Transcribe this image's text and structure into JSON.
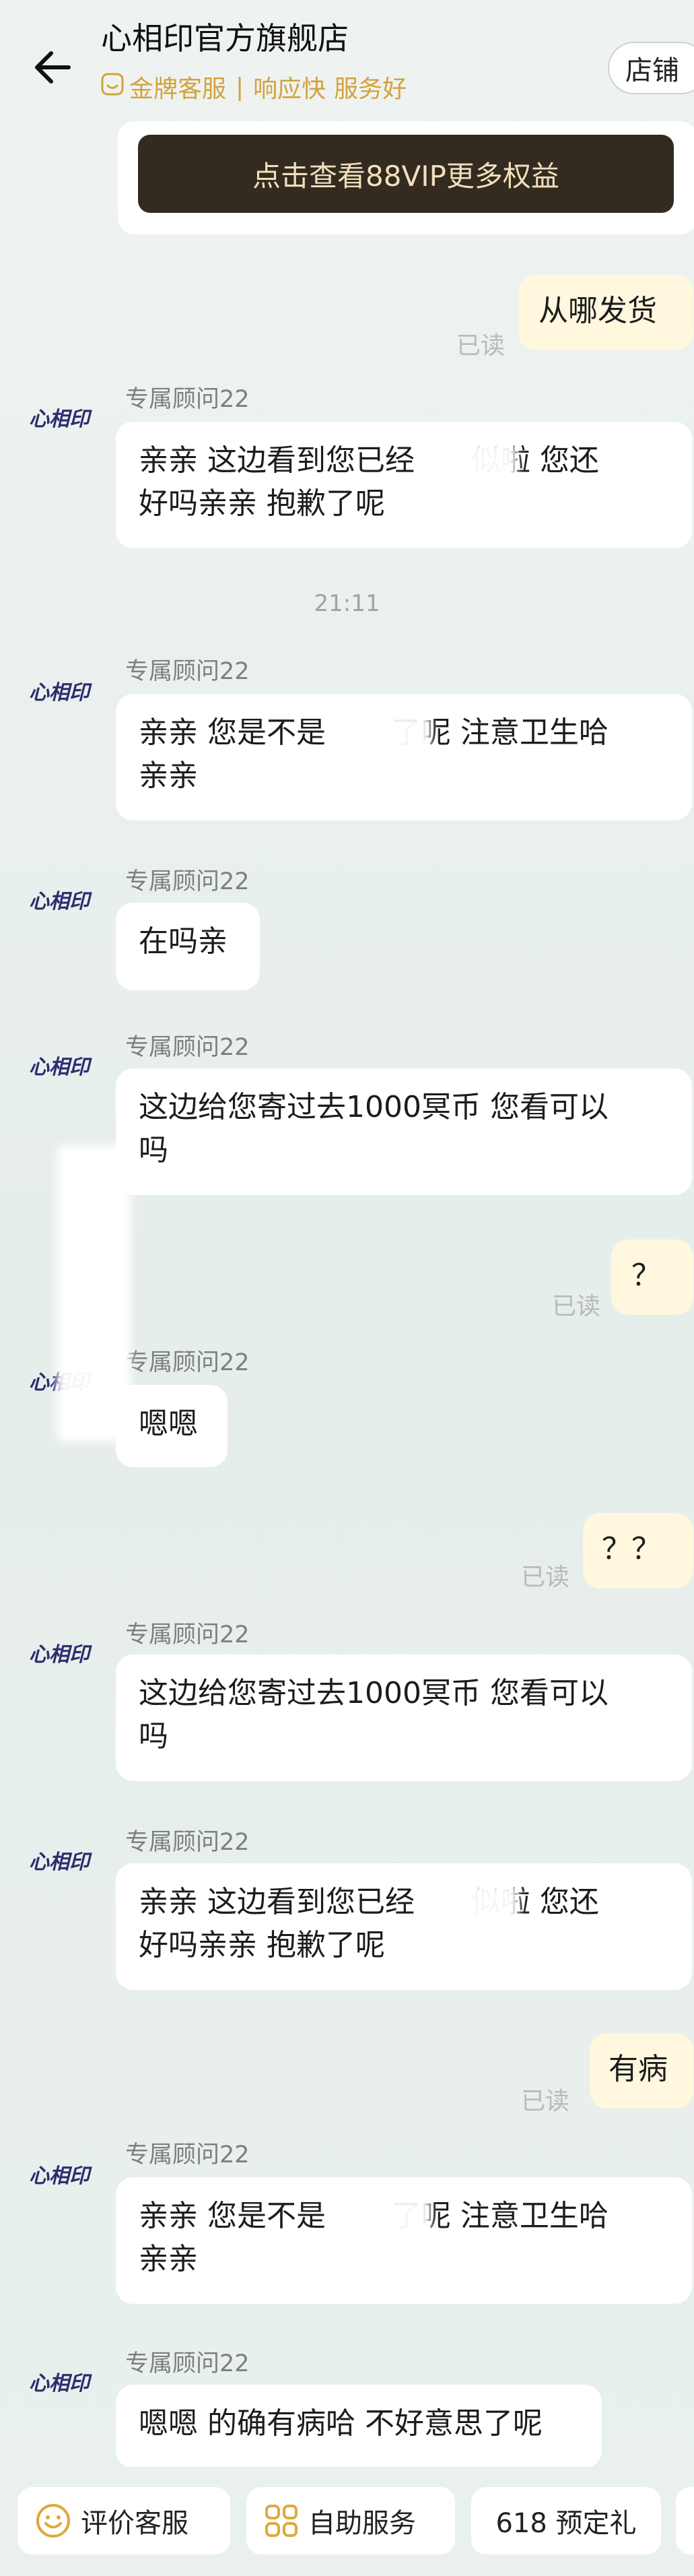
{
  "header": {
    "title": "心相印官方旗舰店",
    "badge": "金牌客服",
    "tag1": "响应快",
    "tag2": "服务好",
    "divider": "|",
    "store_button": "店铺",
    "accent_color": "#d4a23a"
  },
  "vip": {
    "label": "点击查看88VIP更多权益"
  },
  "brand": {
    "avatar_text": "心相印"
  },
  "messages": [
    {
      "from": "me",
      "text": "从哪发货",
      "status": "已读"
    },
    {
      "from": "agent",
      "sender": "专属顾问22",
      "text": "亲亲 这边看到您已经      似啦 您还\n好吗亲亲 抱歉了呢"
    },
    {
      "type": "time",
      "text": "21:11"
    },
    {
      "from": "agent",
      "sender": "专属顾问22",
      "text": "亲亲 您是不是       了呢 注意卫生哈\n亲亲"
    },
    {
      "from": "agent",
      "sender": "专属顾问22",
      "text": "在吗亲"
    },
    {
      "from": "agent",
      "sender": "专属顾问22",
      "text": "这边给您寄过去1000冥币 您看可以\n吗"
    },
    {
      "from": "me",
      "text": "？",
      "status": "已读"
    },
    {
      "from": "agent",
      "sender": "专属顾问22",
      "text": "嗯嗯"
    },
    {
      "from": "me",
      "text": "？？",
      "status": "已读"
    },
    {
      "from": "agent",
      "sender": "专属顾问22",
      "text": "这边给您寄过去1000冥币 您看可以\n吗"
    },
    {
      "from": "agent",
      "sender": "专属顾问22",
      "text": "亲亲 这边看到您已经      似啦 您还\n好吗亲亲 抱歉了呢"
    },
    {
      "from": "me",
      "text": "有病",
      "status": "已读"
    },
    {
      "from": "agent",
      "sender": "专属顾问22",
      "text": "亲亲 您是不是       了呢 注意卫生哈\n亲亲"
    },
    {
      "from": "agent",
      "sender": "专属顾问22",
      "text": "嗯嗯 的确有病哈 不好意思了呢"
    }
  ],
  "bottom": {
    "rate": "评价客服",
    "self_service": "自助服务",
    "presale": "618 预定礼"
  }
}
